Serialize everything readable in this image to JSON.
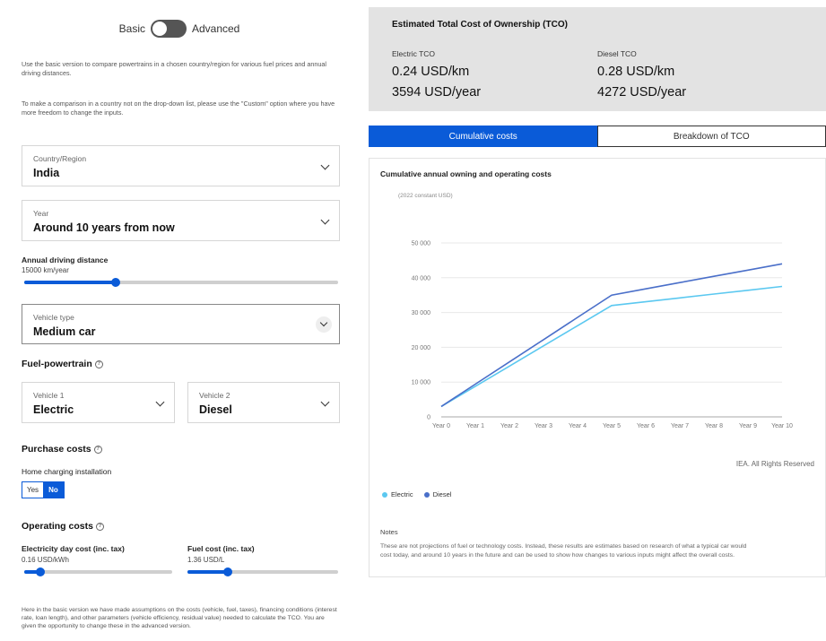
{
  "mode": {
    "basic_label": "Basic",
    "advanced_label": "Advanced",
    "state": "basic"
  },
  "help": {
    "p1": "Use the basic version to compare powertrains in a chosen country/region for various fuel prices and annual driving distances.",
    "p2": "To make a comparison in a country not on the drop-down list, please use the \"Custom\" option where you have more freedom to change the inputs."
  },
  "country": {
    "label": "Country/Region",
    "value": "India"
  },
  "year": {
    "label": "Year",
    "value": "Around 10 years from now"
  },
  "driving": {
    "label": "Annual driving distance",
    "value": "15000 km/year",
    "level": 0.29
  },
  "vehicle_type": {
    "label": "Vehicle type",
    "value": "Medium car"
  },
  "fuel_powertrain": {
    "title": "Fuel-powertrain",
    "vehicle1": {
      "label": "Vehicle 1",
      "value": "Electric"
    },
    "vehicle2": {
      "label": "Vehicle 2",
      "value": "Diesel"
    }
  },
  "purchase": {
    "title": "Purchase costs",
    "home_charging_label": "Home charging installation",
    "yes": "Yes",
    "no": "No",
    "selected": "No"
  },
  "operating": {
    "title": "Operating costs",
    "electricity": {
      "label": "Electricity day cost (inc. tax)",
      "value": "0.16 USD/kWh",
      "level": 0.11
    },
    "fuel": {
      "label": "Fuel cost (inc. tax)",
      "value": "1.36 USD/L",
      "level": 0.27
    }
  },
  "footer_note": "Here in the basic version we have made assumptions on the costs (vehicle, fuel, taxes), financing conditions (interest rate, loan length), and other parameters (vehicle efficiency, residual value) needed to calculate the TCO. You are given the opportunity to change these in the advanced version.",
  "tco": {
    "title": "Estimated Total Cost of Ownership (TCO)",
    "electric": {
      "label": "Electric TCO",
      "per_km": "0.24 USD/km",
      "per_year": "3594 USD/year"
    },
    "diesel": {
      "label": "Diesel TCO",
      "per_km": "0.28 USD/km",
      "per_year": "4272 USD/year"
    }
  },
  "tabs": {
    "cumulative": "Cumulative costs",
    "breakdown": "Breakdown of TCO",
    "active": "cumulative"
  },
  "chart_data": {
    "type": "line",
    "title": "Cumulative annual owning and operating costs",
    "ylabel": "(2022 constant USD)",
    "xlabel": "",
    "categories": [
      "Year 0",
      "Year 1",
      "Year 2",
      "Year 3",
      "Year 4",
      "Year 5",
      "Year 6",
      "Year 7",
      "Year 8",
      "Year 9",
      "Year 10"
    ],
    "ylim": [
      0,
      50000
    ],
    "yticks": [
      0,
      10000,
      20000,
      30000,
      40000,
      50000
    ],
    "ytick_labels": [
      "0",
      "10 000",
      "20 000",
      "30 000",
      "40 000",
      "50 000"
    ],
    "grid": true,
    "legend_position": "bottom-left",
    "series": [
      {
        "name": "Electric",
        "color": "#5bc8f0",
        "values": [
          3000,
          8800,
          14600,
          20400,
          26200,
          32000,
          33100,
          34200,
          35300,
          36400,
          37500
        ]
      },
      {
        "name": "Diesel",
        "color": "#4a6fc9",
        "values": [
          3000,
          9400,
          15800,
          22200,
          28600,
          35000,
          36800,
          38600,
          40400,
          42200,
          44000
        ]
      }
    ]
  },
  "rights": "IEA. All Rights Reserved",
  "notes": {
    "title": "Notes",
    "text": "These are not projections of fuel or technology costs. Instead, these results are estimates based on research of what a typical car would cost today, and around 10 years in the future and can be used to show how changes to various inputs might affect the overall costs."
  },
  "colors": {
    "accent": "#0a5bd8",
    "summary_bg": "#e3e3e3"
  }
}
